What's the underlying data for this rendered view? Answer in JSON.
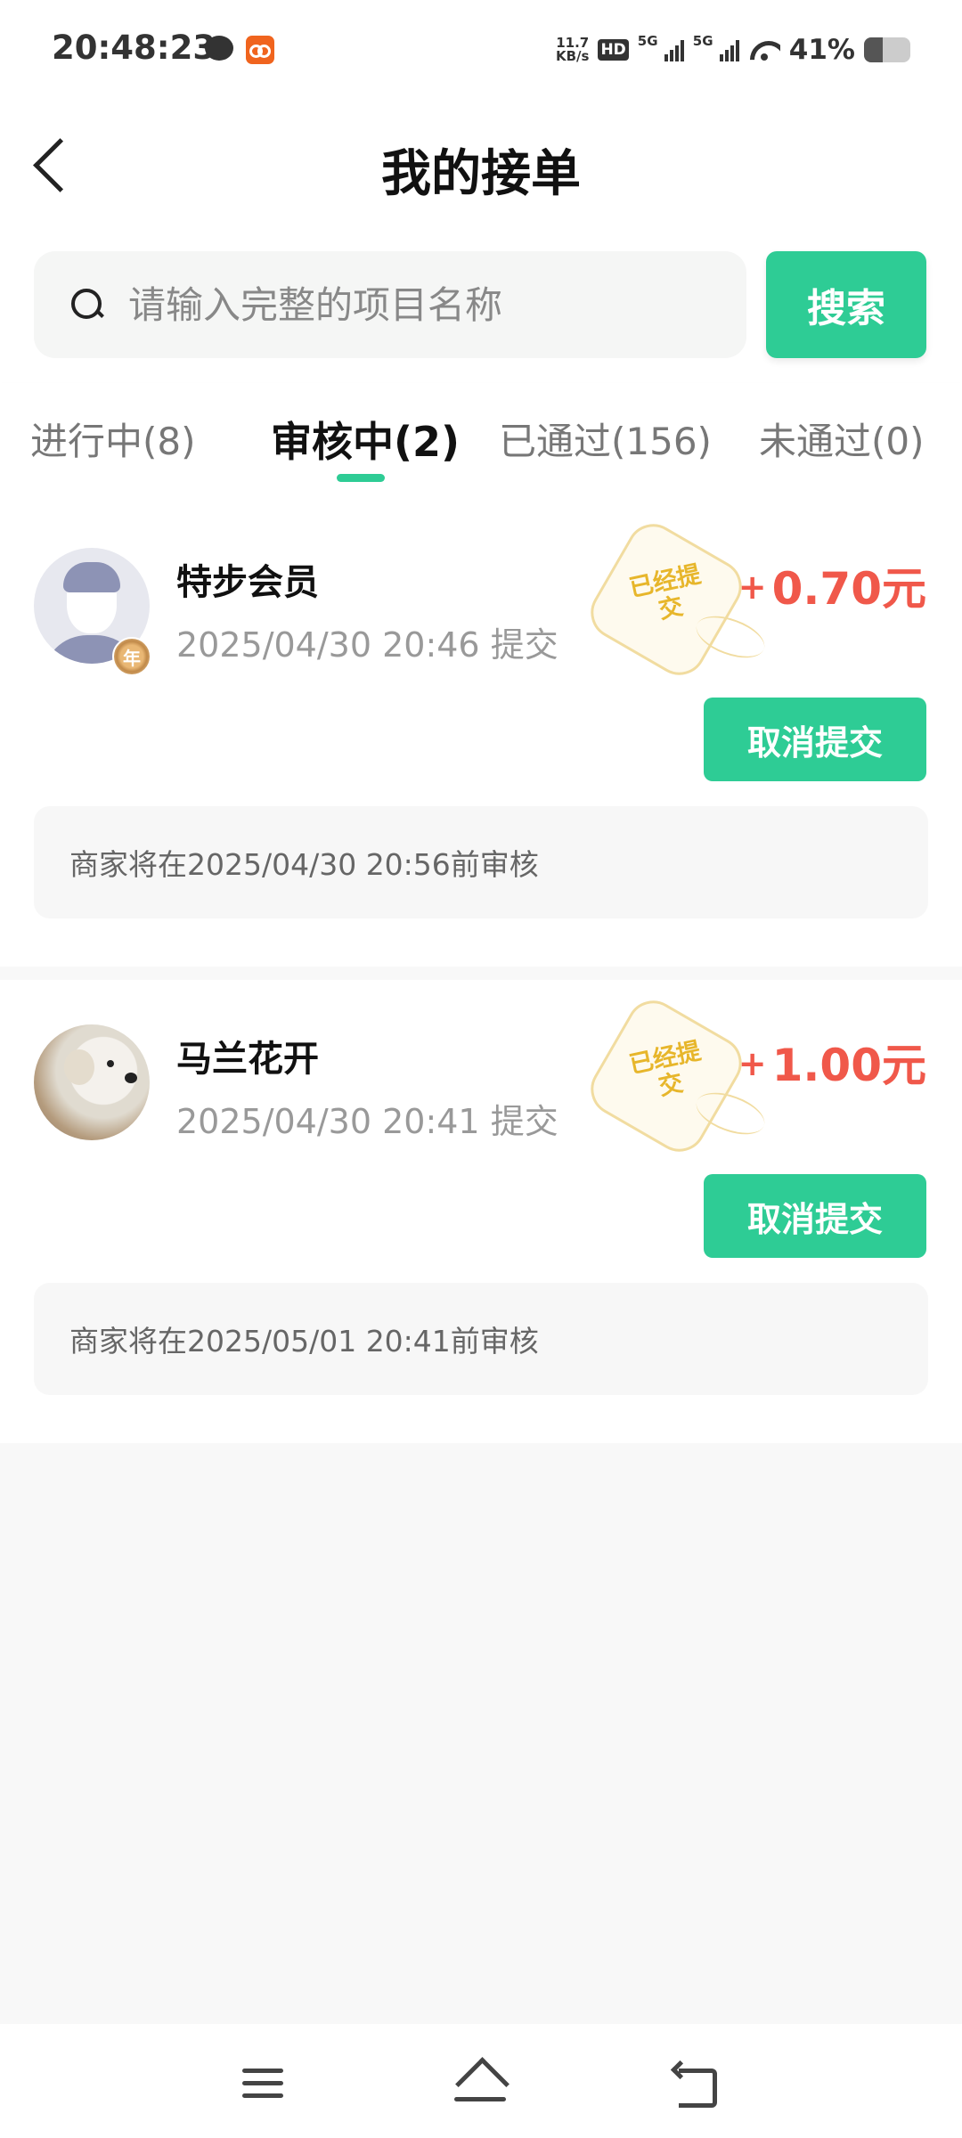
{
  "status_bar": {
    "time": "20:48:23",
    "speed_value": "11.7",
    "speed_unit": "KB/s",
    "hd": "HD",
    "signal_1": "5G",
    "signal_2": "5G",
    "battery_percent": "41%",
    "battery_level": 0.41,
    "icons": [
      "chat-icon",
      "app-notification-icon",
      "wifi-icon",
      "battery-icon"
    ]
  },
  "header": {
    "title": "我的接单",
    "back_icon": "chevron-left-icon"
  },
  "search": {
    "placeholder": "请输入完整的项目名称",
    "value": "",
    "button_label": "搜索"
  },
  "tabs": [
    {
      "label": "进行中(8)",
      "active": false
    },
    {
      "label": "审核中(2)",
      "active": true
    },
    {
      "label": "已通过(156)",
      "active": false
    },
    {
      "label": "未通过(0)",
      "active": false
    }
  ],
  "orders": [
    {
      "username": "特步会员",
      "submit_time": "2025/04/30 20:46 提交",
      "stamp_text": "已经提交",
      "amount_sign": "+",
      "amount": "0.70元",
      "cancel_label": "取消提交",
      "notice": "商家将在2025/04/30 20:56前审核",
      "badge_text": "年"
    },
    {
      "username": "马兰花开",
      "submit_time": "2025/04/30 20:41 提交",
      "stamp_text": "已经提交",
      "amount_sign": "+",
      "amount": "1.00元",
      "cancel_label": "取消提交",
      "notice": "商家将在2025/05/01 20:41前审核"
    }
  ],
  "colors": {
    "accent": "#2ecc95",
    "amount": "#f0584a",
    "stamp": "#e7b62b"
  },
  "nav_bar": {
    "icons": [
      "menu-icon",
      "home-icon",
      "back-icon"
    ]
  }
}
